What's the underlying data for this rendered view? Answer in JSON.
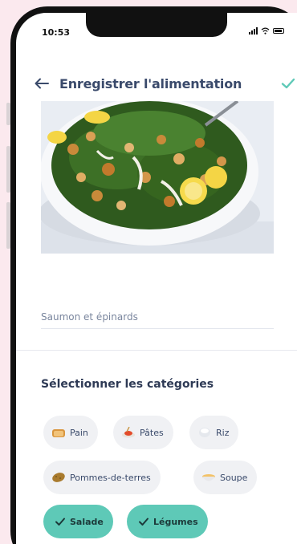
{
  "status_bar": {
    "time": "10:53"
  },
  "header": {
    "title": "Enregistrer l'alimentation"
  },
  "food": {
    "name": "Saumon et épinards"
  },
  "categories": {
    "title": "Sélectionner les catégories",
    "items": [
      {
        "label": "Pain",
        "icon": "bread-icon",
        "selected": false
      },
      {
        "label": "Pâtes",
        "icon": "pasta-icon",
        "selected": false
      },
      {
        "label": "Riz",
        "icon": "rice-icon",
        "selected": false
      },
      {
        "label": "Pommes-de-terres",
        "icon": "potato-icon",
        "selected": false
      },
      {
        "label": "Soupe",
        "icon": "soup-icon",
        "selected": false
      },
      {
        "label": "Salade",
        "icon": "check-icon",
        "selected": true
      },
      {
        "label": "Légumes",
        "icon": "check-icon",
        "selected": true
      }
    ]
  },
  "colors": {
    "accent": "#5ec9b7",
    "title": "#3a4a6b",
    "background": "#fbe9ee"
  }
}
